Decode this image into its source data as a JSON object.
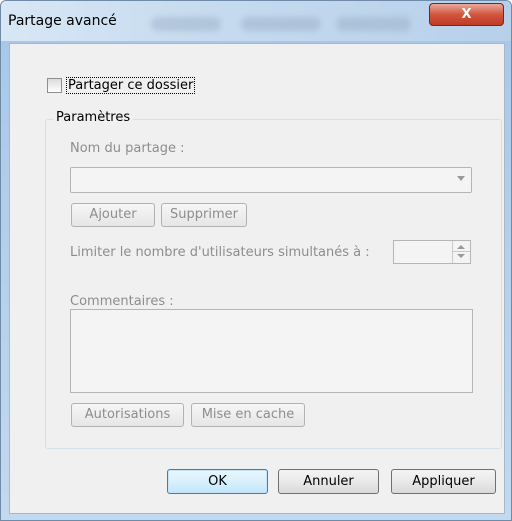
{
  "window": {
    "title": "Partage avancé",
    "close_glyph": "X"
  },
  "share_checkbox": {
    "label": "Partager ce dossier",
    "checked": false
  },
  "parameters": {
    "group_label": "Paramètres",
    "share_name_label": "Nom du partage :",
    "share_name_value": "",
    "add_button": "Ajouter",
    "remove_button": "Supprimer",
    "limit_label": "Limiter le nombre d'utilisateurs simultanés à :",
    "limit_value": "",
    "comments_label": "Commentaires :",
    "comments_value": "",
    "permissions_button": "Autorisations",
    "caching_button": "Mise en cache"
  },
  "footer": {
    "ok": "OK",
    "cancel": "Annuler",
    "apply": "Appliquer"
  },
  "icons": {
    "close": "close-icon",
    "combo_arrow": "chevron-down-icon",
    "spin_up": "chevron-up-icon",
    "spin_down": "chevron-down-icon"
  }
}
